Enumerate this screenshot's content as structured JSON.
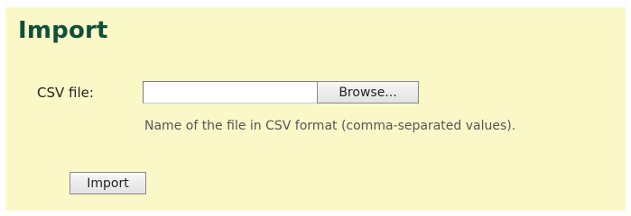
{
  "header": {
    "title": "Import"
  },
  "form": {
    "csv_label": "CSV file:",
    "file_value": "",
    "browse_label": "Browse...",
    "hint": "Name of the file in CSV format (comma-separated values).",
    "submit_label": "Import"
  },
  "colors": {
    "panel_background": "#fbf8c8",
    "title": "#10503a"
  }
}
